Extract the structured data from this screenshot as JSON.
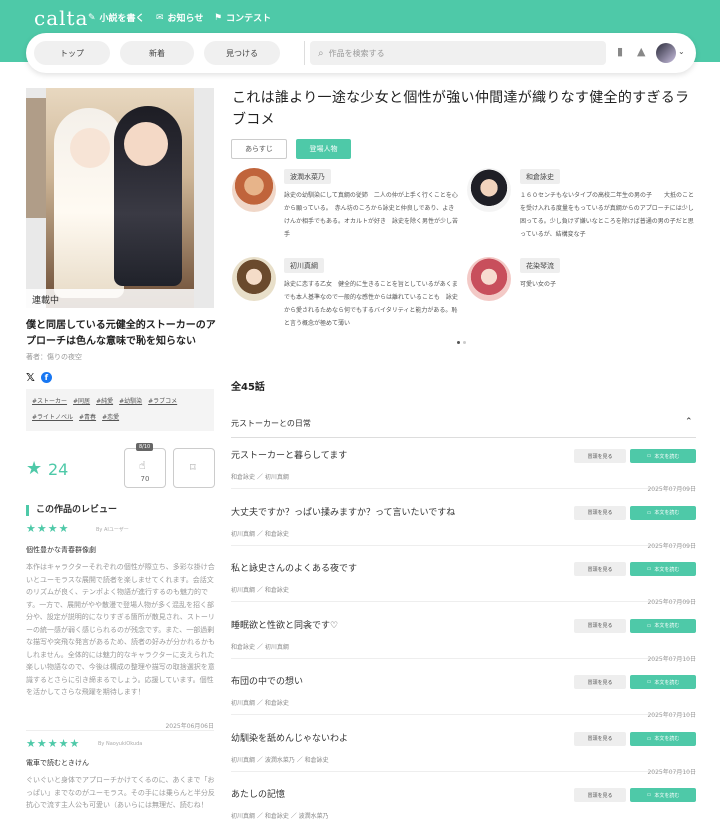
{
  "header": {
    "logo": "calta",
    "nav": [
      {
        "icon": "pen-icon",
        "label": "小説を書く"
      },
      {
        "icon": "mail-icon",
        "label": "お知らせ"
      },
      {
        "icon": "flag-icon",
        "label": "コンテスト"
      }
    ],
    "tabs": [
      "トップ",
      "新着",
      "見つける"
    ],
    "search_placeholder": "作品を検索する"
  },
  "work": {
    "status": "連載中",
    "title": "僕と同居している元健全的ストーカーのアプローチは色んな意味で恥を知らない",
    "author": "著者：傷りの夜空",
    "tags": [
      "#ストーカー",
      "#同居",
      "#純愛",
      "#幼馴染",
      "#ラブコメ",
      "#ライトノベル",
      "#青春",
      "#恋愛"
    ],
    "stars": "24",
    "reaction_count": "70",
    "reaction_badge": "8/10"
  },
  "reviews": {
    "section_title": "この作品のレビュー",
    "items": [
      {
        "stars": "★★★★",
        "by": "By AIユーザー",
        "headline": "個性豊かな青春群像劇",
        "body": "本作はキャラクターそれぞれの個性が際立ち、多彩な掛け合いとユーモラスな展開で読者を楽しませてくれます。会話文のリズムが良く、テンポよく物語が進行するのも魅力的です。一方で、展開がやや散漫で登場人物が多く混乱を招く部分や、設定が説明的になりすぎる箇所が散見され、ストーリーの統一感が弱く感じられるのが残念です。また、一部過剰な描写や突飛な発言があるため、読者の好みが分かれるかもしれません。全体的には魅力的なキャラクターに支えられた楽しい物語なので、今後は構成の整理や描写の取捨選択を意識するとさらに引き締まるでしょう。応援しています。個性を活かしてさらな飛躍を期待します！",
        "date": "2025年06月06日"
      },
      {
        "stars": "★★★★★",
        "by": "By NaoyukiOkuda",
        "headline": "電車で読むときけん",
        "body": "ぐいぐいと身体でアプローチかけてくるのに、あくまで「おっぱい」までなのがユーモラス。その手には乗らんと半分反抗心で流す主人公も可愛い（あいらには無理だ、読むね！"
      }
    ]
  },
  "main": {
    "title": "これは誰より一途な少女と個性が強い仲間達が織りなす健全的すぎるラブコメ",
    "tab_synopsis": "あらすじ",
    "tab_characters": "登場人物",
    "characters": [
      {
        "name": "波潤水菜乃",
        "desc": "詠史の幼馴染にして真綱の従姉　二人の仲が上手く行くことを心から願っている。　赤ん坊のころから詠史と仲良しであり、よきけんか相手でもある。オカルトが好き　詠史を除く男性が少し苦手"
      },
      {
        "name": "和倉詠史",
        "desc": "１６０センチもないタイプの高校二年生の男の子　　大抵のことを受け入れる度量をもっているが真綱からのアプローチには少し困ってる。少し負けず嫌いなところを除けば普通の男の子だと思っているが、結構変な子"
      },
      {
        "name": "初川真綱",
        "desc": "詠史に恋する乙女　健全的に生きることを旨としているがあくまでも本人基準なので一般的な感性からは離れていることも　詠史から愛されるためなら何でもするバイタリティと能力がある。恥と言う概念が極めて薄い"
      },
      {
        "name": "花染琴流",
        "desc": "可愛い女の子"
      }
    ],
    "episode_total": "全45話",
    "chapter": "元ストーカーとの日常",
    "btn_prev": "冒頭を見る",
    "btn_read": "本文を読む",
    "episodes": [
      {
        "title": "元ストーカーと暮らしてます",
        "chars": "和倉詠史 ／ 初川真綱",
        "date": "2025年07月09日"
      },
      {
        "title": "大丈夫ですか？っぱい揉みますか？って言いたいですね",
        "chars": "初川真綱 ／ 和倉詠史",
        "date": "2025年07月09日"
      },
      {
        "title": "私と詠史さんのよくある夜です",
        "chars": "初川真綱 ／ 和倉詠史",
        "date": "2025年07月09日"
      },
      {
        "title": "睡眠欲と性欲と同衾です♡",
        "chars": "和倉詠史 ／ 初川真綱",
        "date": "2025年07月10日"
      },
      {
        "title": "布団の中での想い",
        "chars": "初川真綱 ／ 和倉詠史",
        "date": "2025年07月10日"
      },
      {
        "title": "幼馴染を舐めんじゃないわよ",
        "chars": "初川真綱 ／ 波潤水菜乃 ／ 和倉詠史",
        "date": "2025年07月10日"
      },
      {
        "title": "あたしの記憶",
        "chars": "初川真綱 ／ 和倉詠史 ／ 波潤水菜乃",
        "date": ""
      }
    ]
  },
  "colors": {
    "accent": "#4ec9a8"
  }
}
